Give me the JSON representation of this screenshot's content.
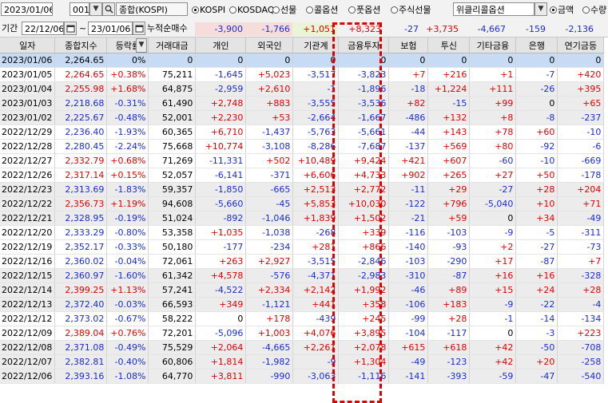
{
  "toolbar": {
    "date": "2023/01/06",
    "code": "001",
    "index_name": "종합(KOSPI)",
    "markets": [
      {
        "label": "KOSPI",
        "selected": true
      },
      {
        "label": "KOSDAQ",
        "selected": false
      },
      {
        "label": "선물",
        "selected": false
      },
      {
        "label": "콜옵션",
        "selected": false
      },
      {
        "label": "풋옵션",
        "selected": false
      },
      {
        "label": "주식선물",
        "selected": false
      }
    ],
    "option_select": "위클리콜옵션",
    "units": [
      {
        "label": "금액",
        "selected": true
      },
      {
        "label": "수량",
        "selected": false
      }
    ]
  },
  "period": {
    "label": "기간",
    "from": "22/12/06",
    "sep": "~",
    "to": "23/01/06",
    "cumulative_label": "누적순매수"
  },
  "summary": [
    "-3,900",
    "-1,766",
    "+1,051",
    "+8,323",
    "-27",
    "+3,735",
    "-4,667",
    "-159",
    "-2,136"
  ],
  "columns": [
    "일자",
    "종합지수",
    "등락률",
    "거래대금",
    "개인",
    "외국인",
    "기관계",
    "금융투자",
    "보험",
    "투신",
    "기타금융",
    "은행",
    "연기금등"
  ],
  "rows": [
    [
      "2023/01/06",
      "2,264.65",
      "0%",
      "0",
      "0",
      "0",
      "0",
      "0",
      "0",
      "0",
      "0",
      "0",
      "0"
    ],
    [
      "2023/01/05",
      "2,264.65",
      "+0.38%",
      "75,211",
      "-1,645",
      "+5,023",
      "-3,517",
      "-3,823",
      "+7",
      "+216",
      "+1",
      "-7",
      "+420"
    ],
    [
      "2023/01/04",
      "2,255.98",
      "+1.68%",
      "64,875",
      "-2,959",
      "+2,610",
      "-1",
      "-1,896",
      "-18",
      "+1,224",
      "+111",
      "-26",
      "+395"
    ],
    [
      "2023/01/03",
      "2,218.68",
      "-0.31%",
      "61,490",
      "+2,748",
      "+883",
      "-3,555",
      "-3,536",
      "+82",
      "-15",
      "+99",
      "0",
      "+65"
    ],
    [
      "2023/01/02",
      "2,225.67",
      "-0.48%",
      "52,001",
      "+2,230",
      "+53",
      "-2,664",
      "-1,667",
      "-486",
      "+132",
      "+8",
      "-8",
      "-237"
    ],
    [
      "2022/12/29",
      "2,236.40",
      "-1.93%",
      "60,365",
      "+6,710",
      "-1,437",
      "-5,763",
      "-5,661",
      "-44",
      "+143",
      "+78",
      "+60",
      "-10"
    ],
    [
      "2022/12/28",
      "2,280.45",
      "-2.24%",
      "75,668",
      "+10,774",
      "-3,108",
      "-8,286",
      "-7,687",
      "-137",
      "+569",
      "+80",
      "-92",
      "-6"
    ],
    [
      "2022/12/27",
      "2,332.79",
      "+0.68%",
      "71,269",
      "-11,331",
      "+502",
      "+10,489",
      "+9,424",
      "+421",
      "+607",
      "-60",
      "-10",
      "-669"
    ],
    [
      "2022/12/26",
      "2,317.14",
      "+0.15%",
      "52,057",
      "-6,141",
      "-371",
      "+6,606",
      "+4,733",
      "+902",
      "+265",
      "+27",
      "+50",
      "-178"
    ],
    [
      "2022/12/23",
      "2,313.69",
      "-1.83%",
      "59,357",
      "-1,850",
      "-665",
      "+2,513",
      "+2,772",
      "-11",
      "+29",
      "-27",
      "+28",
      "+204"
    ],
    [
      "2022/12/22",
      "2,356.73",
      "+1.19%",
      "94,608",
      "-5,660",
      "-45",
      "+5,853",
      "+10,030",
      "-122",
      "+796",
      "-5,040",
      "+10",
      "+71"
    ],
    [
      "2022/12/21",
      "2,328.95",
      "-0.19%",
      "51,024",
      "-892",
      "-1,046",
      "+1,839",
      "+1,502",
      "-21",
      "+59",
      "0",
      "+34",
      "-49"
    ],
    [
      "2022/12/20",
      "2,333.29",
      "-0.80%",
      "53,358",
      "+1,035",
      "-1,038",
      "-268",
      "+339",
      "-116",
      "-103",
      "-9",
      "-5",
      "-311"
    ],
    [
      "2022/12/19",
      "2,352.17",
      "-0.33%",
      "50,180",
      "-177",
      "-234",
      "+281",
      "+866",
      "-140",
      "-93",
      "+2",
      "-27",
      "-73"
    ],
    [
      "2022/12/16",
      "2,360.02",
      "-0.04%",
      "72,061",
      "+263",
      "+2,927",
      "-3,515",
      "-2,846",
      "-103",
      "-290",
      "+17",
      "-87",
      "+7"
    ],
    [
      "2022/12/15",
      "2,360.97",
      "-1.60%",
      "61,342",
      "+4,578",
      "-576",
      "-4,371",
      "-2,983",
      "-310",
      "-87",
      "+16",
      "+16",
      "-328"
    ],
    [
      "2022/12/14",
      "2,399.25",
      "+1.13%",
      "57,241",
      "-4,522",
      "+2,334",
      "+2,142",
      "+1,992",
      "-46",
      "+89",
      "+15",
      "+24",
      "+28"
    ],
    [
      "2022/12/13",
      "2,372.40",
      "-0.03%",
      "66,593",
      "+349",
      "-1,121",
      "+441",
      "+358",
      "-106",
      "+183",
      "-9",
      "-22",
      "-4"
    ],
    [
      "2022/12/12",
      "2,373.02",
      "-0.67%",
      "58,222",
      "0",
      "+178",
      "-439",
      "+245",
      "-99",
      "+28",
      "-1",
      "-14",
      "-134"
    ],
    [
      "2022/12/09",
      "2,389.04",
      "+0.76%",
      "72,201",
      "-5,096",
      "+1,003",
      "+4,076",
      "+3,895",
      "-104",
      "-117",
      "0",
      "-3",
      "+223"
    ],
    [
      "2022/12/08",
      "2,371.08",
      "-0.49%",
      "75,529",
      "+2,064",
      "-4,665",
      "+2,261",
      "+2,078",
      "+615",
      "+618",
      "+42",
      "-50",
      "-708"
    ],
    [
      "2022/12/07",
      "2,382.81",
      "-0.40%",
      "60,806",
      "+1,814",
      "-1,982",
      "-9",
      "+1,304",
      "-49",
      "-123",
      "+42",
      "+20",
      "-258"
    ],
    [
      "2022/12/06",
      "2,393.16",
      "-1.08%",
      "64,770",
      "+3,811",
      "-990",
      "-3,063",
      "-1,116",
      "-141",
      "-393",
      "-59",
      "-47",
      "-540"
    ]
  ],
  "colors": {
    "positive": "#e00000",
    "negative": "#1a2cd4",
    "selected_row": "#c7dcf4",
    "alt_row": "#ececec",
    "highlight": "#e00000"
  }
}
